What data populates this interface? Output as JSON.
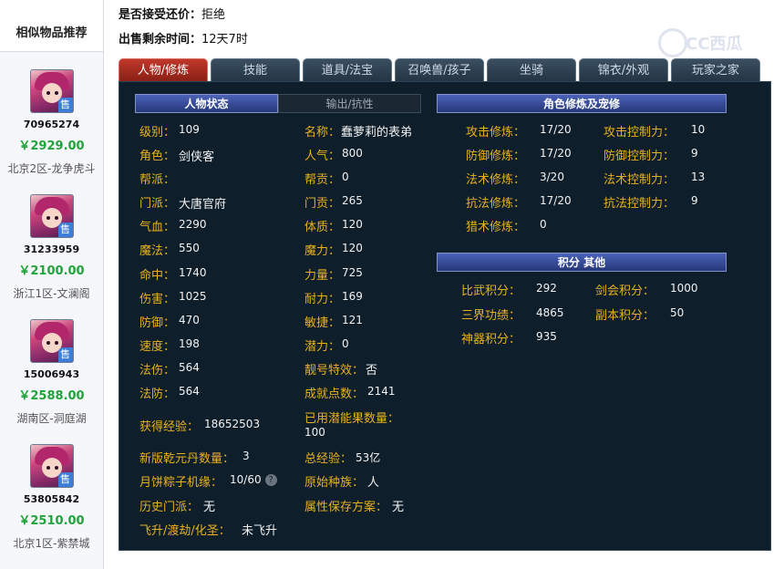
{
  "sidebar": {
    "title": "相似物品推荐",
    "items": [
      {
        "code": "70965274",
        "price": "￥2929.00",
        "server": "北京2区-龙争虎斗"
      },
      {
        "code": "31233959",
        "price": "￥2100.00",
        "server": "浙江1区-文澜阁"
      },
      {
        "code": "15006943",
        "price": "￥2588.00",
        "server": "湖南区-洞庭湖"
      },
      {
        "code": "53805842",
        "price": "￥2510.00",
        "server": "北京1区-紫禁城"
      }
    ],
    "badge": "售"
  },
  "info": {
    "bargain_label": "是否接受还价：",
    "bargain_value": "拒绝",
    "time_label": "出售剩余时间：",
    "time_value": "12天7时"
  },
  "logo": "CC西瓜",
  "tabs": [
    "人物/修炼",
    "技能",
    "道具/法宝",
    "召唤兽/孩子",
    "坐骑",
    "锦衣/外观",
    "玩家之家"
  ],
  "headers": {
    "status": "人物状态",
    "output": "输出/抗性",
    "cultivation": "角色修炼及宠修",
    "points": "积分 其他"
  },
  "stats_left": [
    {
      "label": "级别：",
      "value": "109"
    },
    {
      "label": "角色：",
      "value": "剑侠客"
    },
    {
      "label": "帮派：",
      "value": ""
    },
    {
      "label": "门派：",
      "value": "大唐官府"
    },
    {
      "label": "气血：",
      "value": "2290"
    },
    {
      "label": "魔法：",
      "value": "550"
    },
    {
      "label": "命中：",
      "value": "1740"
    },
    {
      "label": "伤害：",
      "value": "1025"
    },
    {
      "label": "防御：",
      "value": "470"
    },
    {
      "label": "速度：",
      "value": "198"
    },
    {
      "label": "法伤：",
      "value": "564"
    },
    {
      "label": "法防：",
      "value": "564"
    }
  ],
  "stats_right": [
    {
      "label": "名称：",
      "value": "蠢萝莉的表弟"
    },
    {
      "label": "人气：",
      "value": "800"
    },
    {
      "label": "帮贡：",
      "value": "0"
    },
    {
      "label": "门贡：",
      "value": "265"
    },
    {
      "label": "体质：",
      "value": "120"
    },
    {
      "label": "魔力：",
      "value": "120"
    },
    {
      "label": "力量：",
      "value": "725"
    },
    {
      "label": "耐力：",
      "value": "169"
    },
    {
      "label": "敏捷：",
      "value": "121"
    },
    {
      "label": "潜力：",
      "value": "0"
    },
    {
      "label": "靓号特效：",
      "value": "否"
    },
    {
      "label": "成就点数：",
      "value": "2141"
    }
  ],
  "extra_left": [
    {
      "label": "获得经验：",
      "value": "18652503"
    },
    {
      "label": "新版乾元丹数量：",
      "value": "3"
    },
    {
      "label": "月饼粽子机缘：",
      "value": "10/60",
      "help": "?"
    },
    {
      "label": "历史门派：",
      "value": "无"
    },
    {
      "label": "飞升/渡劫/化圣：",
      "value": "未飞升"
    }
  ],
  "extra_right": [
    {
      "label": "已用潜能果数量：",
      "value": "100"
    },
    {
      "label": "总经验：",
      "value": "53亿"
    },
    {
      "label": "原始种族：",
      "value": "人"
    },
    {
      "label": "属性保存方案：",
      "value": "无"
    }
  ],
  "cultivation": [
    {
      "label": "攻击修炼：",
      "value": "17/20",
      "label2": "攻击控制力：",
      "value2": "10"
    },
    {
      "label": "防御修炼：",
      "value": "17/20",
      "label2": "防御控制力：",
      "value2": "9"
    },
    {
      "label": "法术修炼：",
      "value": "3/20",
      "label2": "法术控制力：",
      "value2": "13"
    },
    {
      "label": "抗法修炼：",
      "value": "17/20",
      "label2": "抗法控制力：",
      "value2": "9"
    },
    {
      "label": "猎术修炼：",
      "value": "0"
    }
  ],
  "points": [
    {
      "label": "比武积分：",
      "value": "292",
      "label2": "剑会积分：",
      "value2": "1000"
    },
    {
      "label": "三界功绩：",
      "value": "4865",
      "label2": "副本积分：",
      "value2": "50"
    },
    {
      "label": "神器积分：",
      "value": "935"
    }
  ]
}
